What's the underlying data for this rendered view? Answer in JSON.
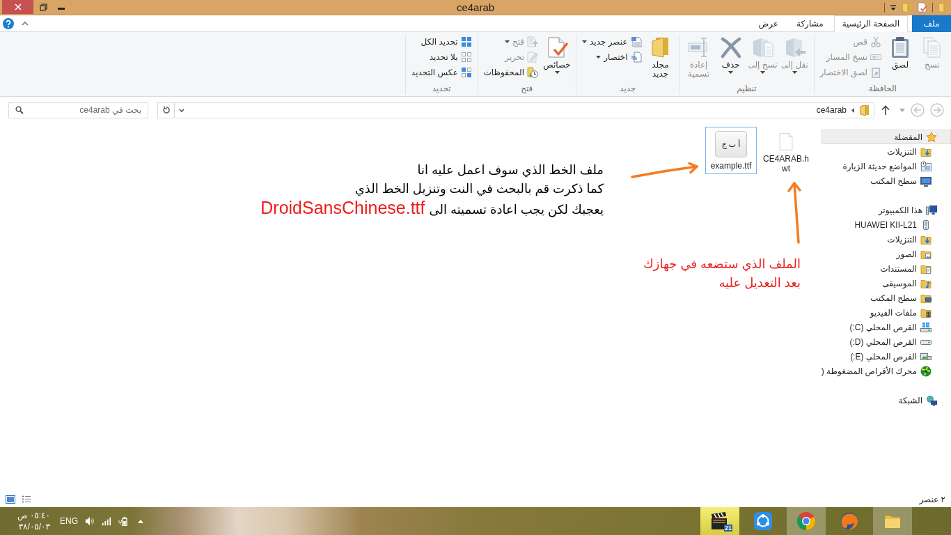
{
  "window": {
    "title": "ce4arab"
  },
  "ribbon": {
    "tabs": [
      {
        "label": "ملف",
        "kind": "file",
        "selected": false
      },
      {
        "label": "الصفحة الرئيسية",
        "kind": "tab",
        "selected": true
      },
      {
        "label": "مشاركة",
        "kind": "tab",
        "selected": false
      },
      {
        "label": "عرض",
        "kind": "tab",
        "selected": false
      }
    ],
    "groups": [
      {
        "label": "الحافظة",
        "commands": [
          {
            "label": "نسخ",
            "kind": "large",
            "disabled": true,
            "menu": false
          },
          {
            "label": "لصق",
            "kind": "large",
            "disabled": false,
            "menu": false
          },
          {
            "label": "قص",
            "kind": "small",
            "disabled": true,
            "menu": false
          },
          {
            "label": "نسخ المسار",
            "kind": "small",
            "disabled": true,
            "menu": false
          },
          {
            "label": "لصق الاختصار",
            "kind": "small",
            "disabled": true,
            "menu": false
          }
        ]
      },
      {
        "label": "تنظيم",
        "commands": [
          {
            "label": "نقل إلى",
            "kind": "large",
            "disabled": true,
            "menu": true
          },
          {
            "label": "نسخ إلى",
            "kind": "large",
            "disabled": true,
            "menu": true
          },
          {
            "label": "حذف",
            "kind": "large",
            "disabled": false,
            "menu": true
          },
          {
            "label": "إعادة تسمية",
            "kind": "large",
            "disabled": true,
            "menu": false
          }
        ]
      },
      {
        "label": "جديد",
        "commands": [
          {
            "label": "مجلد جديد",
            "kind": "large",
            "disabled": false,
            "menu": false
          },
          {
            "label": "عنصر جديد",
            "kind": "small",
            "disabled": false,
            "menu": true
          },
          {
            "label": "اختصار",
            "kind": "small",
            "disabled": false,
            "menu": true
          }
        ]
      },
      {
        "label": "فتح",
        "commands": [
          {
            "label": "خصائص",
            "kind": "large",
            "disabled": false,
            "menu": true
          },
          {
            "label": "فتح",
            "kind": "small",
            "disabled": true,
            "menu": true
          },
          {
            "label": "تحرير",
            "kind": "small",
            "disabled": true,
            "menu": false
          },
          {
            "label": "المحفوظات",
            "kind": "small",
            "disabled": false,
            "menu": false
          }
        ]
      },
      {
        "label": "تحديد",
        "commands": [
          {
            "label": "تحديد الكل",
            "kind": "small",
            "disabled": false,
            "menu": false
          },
          {
            "label": "بلا تحديد",
            "kind": "small",
            "disabled": false,
            "menu": false
          },
          {
            "label": "عكس التحديد",
            "kind": "small",
            "disabled": false,
            "menu": false
          }
        ]
      }
    ]
  },
  "address_bar": {
    "path": [
      "ce4arab"
    ],
    "search": {
      "placeholder": "بحث في ce4arab"
    }
  },
  "navigation": {
    "sections": [
      {
        "label": "المفضلة",
        "selected": true,
        "children": [
          {
            "label": "التنزيلات",
            "selected": false
          },
          {
            "label": "المواضع حديثة الزيارة",
            "selected": false
          },
          {
            "label": "سطح المكتب",
            "selected": false
          }
        ]
      },
      {
        "label": "هذا الكمبيوتر",
        "selected": false,
        "children": [
          {
            "label": "HUAWEI KII-L21",
            "selected": false
          },
          {
            "label": "التنزيلات",
            "selected": false
          },
          {
            "label": "الصور",
            "selected": false
          },
          {
            "label": "المستندات",
            "selected": false
          },
          {
            "label": "الموسيقى",
            "selected": false
          },
          {
            "label": "سطح المكتب",
            "selected": false
          },
          {
            "label": "ملفات الفيديو",
            "selected": false
          },
          {
            "label": "القرص المحلي (C:)",
            "selected": false
          },
          {
            "label": "القرص المحلي (D:)",
            "selected": false
          },
          {
            "label": "القرص المحلي (E:)",
            "selected": false
          },
          {
            "label": "محرك الأقراص المضغوطة (",
            "selected": false
          }
        ]
      },
      {
        "label": "الشبكة",
        "selected": false
      }
    ]
  },
  "files": [
    {
      "name": "CE4ARAB.hwt",
      "kind": "document",
      "selected": false
    },
    {
      "name": "example.ttf",
      "kind": "font",
      "preview": "أ ب ج",
      "selected": true
    }
  ],
  "annotations": [
    {
      "lines": [
        "ملف الخط الذي سوف اعمل عليه انا",
        "كما ذكرت قم بالبحث في النت وتنزيل الخط الذي",
        "يعجبك لكن يجب اعادة تسميته الى"
      ],
      "highlight": "DroidSansChinese.ttf",
      "color": "#000000"
    },
    {
      "lines": [
        "الملف الذي ستضعه في جهازك",
        "بعد التعديل عليه"
      ],
      "color": "#ee1c1c"
    }
  ],
  "status_bar": {
    "item_count": "٢ عنصر"
  },
  "taskbar": {
    "clock": {
      "time": "٠٥:٤٠ ص",
      "date": "٣٨/٠٥/٠٣"
    },
    "language": "ENG",
    "apps": [
      {
        "kind": "clapper",
        "badge": "21",
        "running": true
      },
      {
        "kind": "share",
        "running": false
      },
      {
        "kind": "ring",
        "running": true
      },
      {
        "kind": "fox",
        "running": false
      },
      {
        "kind": "folder",
        "running": true
      }
    ]
  }
}
